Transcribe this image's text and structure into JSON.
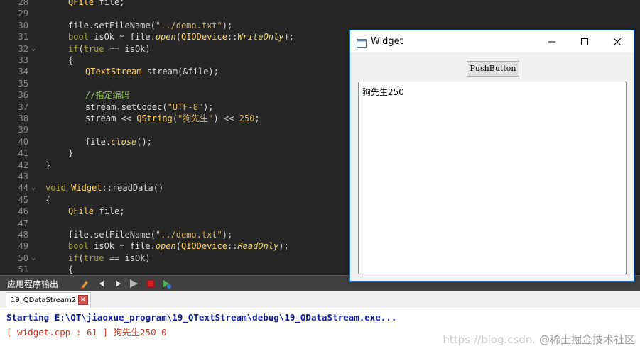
{
  "editor": {
    "lines": [
      {
        "num": "28",
        "fold": "",
        "indent": 1,
        "segments": [
          {
            "t": "QFile",
            "c": "cls"
          },
          {
            "t": " file;",
            "c": ""
          }
        ]
      },
      {
        "num": "29",
        "fold": "",
        "indent": 0,
        "segments": []
      },
      {
        "num": "30",
        "fold": "",
        "indent": 1,
        "segments": [
          {
            "t": "file.setFileName(",
            "c": ""
          },
          {
            "t": "\"../demo.txt\"",
            "c": "str"
          },
          {
            "t": ");",
            "c": ""
          }
        ]
      },
      {
        "num": "31",
        "fold": "",
        "indent": 1,
        "segments": [
          {
            "t": "bool",
            "c": "type"
          },
          {
            "t": " isOk = file.",
            "c": ""
          },
          {
            "t": "open",
            "c": "ital"
          },
          {
            "t": "(",
            "c": ""
          },
          {
            "t": "QIODevice",
            "c": "cls"
          },
          {
            "t": "::",
            "c": ""
          },
          {
            "t": "WriteOnly",
            "c": "ital"
          },
          {
            "t": ");",
            "c": ""
          }
        ]
      },
      {
        "num": "32",
        "fold": "⌄",
        "indent": 1,
        "segments": [
          {
            "t": "if",
            "c": "type"
          },
          {
            "t": "(",
            "c": ""
          },
          {
            "t": "true",
            "c": "type"
          },
          {
            "t": " == isOk)",
            "c": ""
          }
        ]
      },
      {
        "num": "33",
        "fold": "",
        "indent": 1,
        "segments": [
          {
            "t": "{",
            "c": ""
          }
        ]
      },
      {
        "num": "34",
        "fold": "",
        "indent": 2,
        "segments": [
          {
            "t": "QTextStream",
            "c": "cls"
          },
          {
            "t": " stream(&file);",
            "c": ""
          }
        ]
      },
      {
        "num": "35",
        "fold": "",
        "indent": 0,
        "segments": []
      },
      {
        "num": "36",
        "fold": "",
        "indent": 2,
        "segments": [
          {
            "t": "//指定编码",
            "c": "cmt"
          }
        ]
      },
      {
        "num": "37",
        "fold": "",
        "indent": 2,
        "segments": [
          {
            "t": "stream.setCodec(",
            "c": ""
          },
          {
            "t": "\"UTF-8\"",
            "c": "str"
          },
          {
            "t": ");",
            "c": ""
          }
        ]
      },
      {
        "num": "38",
        "fold": "",
        "indent": 2,
        "segments": [
          {
            "t": "stream << ",
            "c": ""
          },
          {
            "t": "QString",
            "c": "cls"
          },
          {
            "t": "(",
            "c": ""
          },
          {
            "t": "\"狗先生\"",
            "c": "str"
          },
          {
            "t": ") << ",
            "c": ""
          },
          {
            "t": "250",
            "c": "num"
          },
          {
            "t": ";",
            "c": ""
          }
        ]
      },
      {
        "num": "39",
        "fold": "",
        "indent": 0,
        "segments": []
      },
      {
        "num": "40",
        "fold": "",
        "indent": 2,
        "segments": [
          {
            "t": "file.",
            "c": ""
          },
          {
            "t": "close",
            "c": "ital"
          },
          {
            "t": "();",
            "c": ""
          }
        ]
      },
      {
        "num": "41",
        "fold": "",
        "indent": 1,
        "segments": [
          {
            "t": "}",
            "c": ""
          }
        ]
      },
      {
        "num": "42",
        "fold": "",
        "indent": 0,
        "segments": [
          {
            "t": "}",
            "c": ""
          }
        ]
      },
      {
        "num": "43",
        "fold": "",
        "indent": 0,
        "segments": []
      },
      {
        "num": "44",
        "fold": "⌄",
        "indent": 0,
        "segments": [
          {
            "t": "void",
            "c": "type"
          },
          {
            "t": " ",
            "c": ""
          },
          {
            "t": "Widget",
            "c": "cls"
          },
          {
            "t": "::readData()",
            "c": ""
          }
        ]
      },
      {
        "num": "45",
        "fold": "",
        "indent": 0,
        "segments": [
          {
            "t": "{",
            "c": ""
          }
        ]
      },
      {
        "num": "46",
        "fold": "",
        "indent": 1,
        "segments": [
          {
            "t": "QFile",
            "c": "cls"
          },
          {
            "t": " file;",
            "c": ""
          }
        ]
      },
      {
        "num": "47",
        "fold": "",
        "indent": 0,
        "segments": []
      },
      {
        "num": "48",
        "fold": "",
        "indent": 1,
        "segments": [
          {
            "t": "file.setFileName(",
            "c": ""
          },
          {
            "t": "\"../demo.txt\"",
            "c": "str"
          },
          {
            "t": ");",
            "c": ""
          }
        ]
      },
      {
        "num": "49",
        "fold": "",
        "indent": 1,
        "segments": [
          {
            "t": "bool",
            "c": "type"
          },
          {
            "t": " isOk = file.",
            "c": ""
          },
          {
            "t": "open",
            "c": "ital"
          },
          {
            "t": "(",
            "c": ""
          },
          {
            "t": "QIODevice",
            "c": "cls"
          },
          {
            "t": "::",
            "c": ""
          },
          {
            "t": "ReadOnly",
            "c": "ital"
          },
          {
            "t": ");",
            "c": ""
          }
        ]
      },
      {
        "num": "50",
        "fold": "⌄",
        "indent": 1,
        "segments": [
          {
            "t": "if",
            "c": "type"
          },
          {
            "t": "(",
            "c": ""
          },
          {
            "t": "true",
            "c": "type"
          },
          {
            "t": " == isOk)",
            "c": ""
          }
        ]
      },
      {
        "num": "51",
        "fold": "",
        "indent": 1,
        "segments": [
          {
            "t": "{",
            "c": ""
          }
        ]
      }
    ]
  },
  "output_panel": {
    "title": "应用程序输出",
    "tab_label": "19_QDataStream2",
    "tab_close": "×",
    "lines": [
      "Starting E:\\QT\\jiaoxue_program\\19_QTextStream\\debug\\19_QDataStream.exe...",
      "[ widget.cpp : 61 ] 狗先生250 0"
    ],
    "watermark_url": "https://blog.csdn.",
    "watermark_site": "@稀土掘金技术社区"
  },
  "widget_window": {
    "title": "Widget",
    "button_label": "PushButton",
    "text_content": "狗先生250"
  }
}
